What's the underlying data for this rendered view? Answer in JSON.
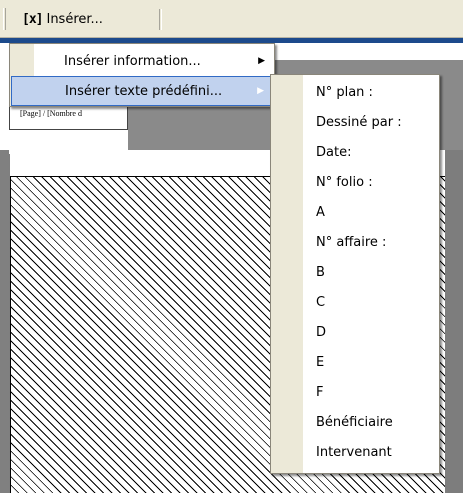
{
  "toolbar": {
    "insert_icon": "[x]",
    "insert_label": "Insérer..."
  },
  "document": {
    "field_text": "[Page] / [Nombre d"
  },
  "menu_main": {
    "items": [
      {
        "label": "Insérer information...",
        "has_submenu": true,
        "highlighted": false
      },
      {
        "label": "Insérer texte prédéfini...",
        "has_submenu": true,
        "highlighted": true
      }
    ],
    "arrow_glyph": "▶"
  },
  "submenu": {
    "items": [
      {
        "label": "N° plan :"
      },
      {
        "label": "Dessiné par :"
      },
      {
        "label": "Date:"
      },
      {
        "label": "N° folio :"
      },
      {
        "label": "A"
      },
      {
        "label": "N° affaire :"
      },
      {
        "label": "B"
      },
      {
        "label": "C"
      },
      {
        "label": "D"
      },
      {
        "label": "E"
      },
      {
        "label": "F"
      },
      {
        "label": "Bénéficiaire"
      },
      {
        "label": "Intervenant"
      }
    ]
  },
  "colors": {
    "toolbar_bg": "#ece9d8",
    "highlight_bg": "#c1d2ee",
    "highlight_border": "#316ac5",
    "title_blue": "#1c4a8c"
  }
}
